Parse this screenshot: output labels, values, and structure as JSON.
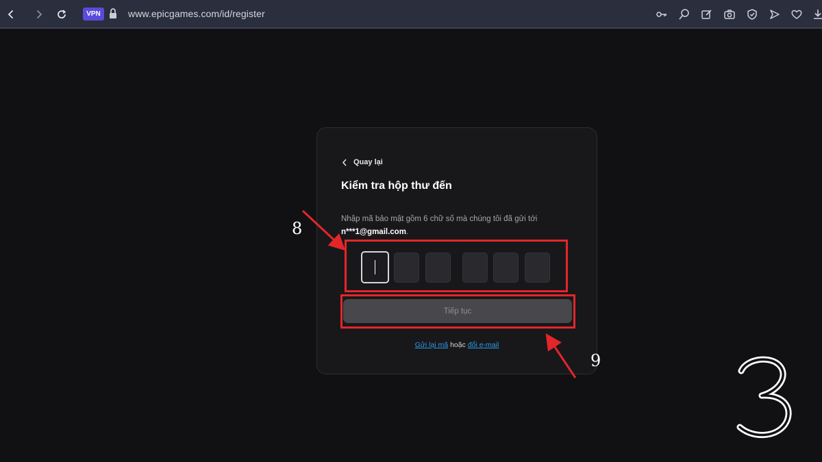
{
  "browser": {
    "vpn_label": "VPN",
    "url": "www.epicgames.com/id/register",
    "icons": [
      "back-arrow-icon",
      "forward-arrow-icon",
      "reload-icon",
      "lock-icon",
      "key-icon",
      "search-icon",
      "edit-icon",
      "camera-icon",
      "shield-icon",
      "send-icon",
      "heart-icon",
      "download-icon"
    ]
  },
  "card": {
    "back_label": "Quay lại",
    "title": "Kiểm tra hộp thư đến",
    "instruction_text": "Nhập mã bảo mật gồm 6 chữ số mà chúng tôi đã gửi tới",
    "email": "n***1@gmail.com",
    "email_suffix": ".",
    "code_digits": [
      "",
      "",
      "",
      "",
      "",
      ""
    ],
    "continue_label": "Tiếp tục",
    "resend_label": "Gửi lại mã",
    "or_label": "hoặc",
    "change_email_label": "đổi e-mail"
  },
  "annotations": {
    "label_8": "8",
    "label_9": "9",
    "step_number": "3",
    "highlight_color": "#e3262a"
  },
  "colors": {
    "background": "#111113",
    "card": "#18181b",
    "link": "#2c9be6",
    "vpn": "#5b4bdb"
  }
}
